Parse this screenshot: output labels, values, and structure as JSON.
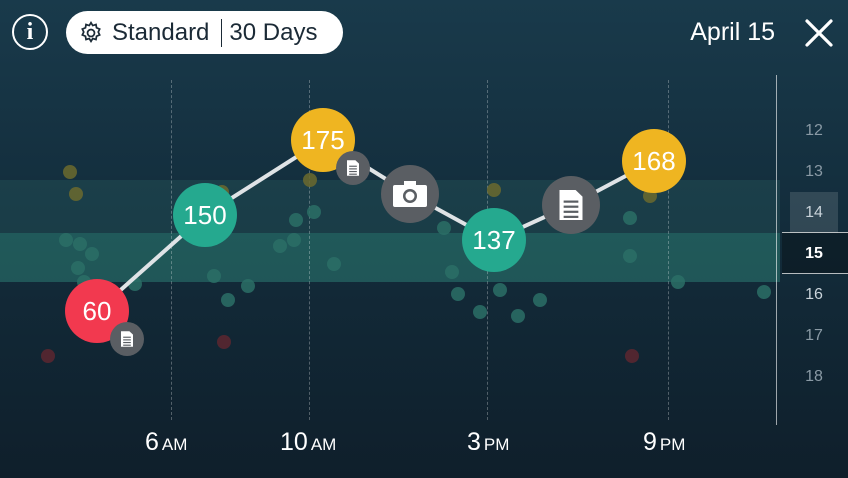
{
  "header": {
    "info_icon": "info-icon",
    "info_glyph": "i",
    "filter": {
      "mode": "Standard",
      "period": "30 Days",
      "icon": "gear-icon"
    },
    "date": "April 15",
    "close_icon": "close-icon"
  },
  "colors": {
    "high": "#efb521",
    "in_range": "#25a98f",
    "low": "#f2394f",
    "note_badge": "#5a5e63",
    "line": "#dfe3e6"
  },
  "chart_data": {
    "type": "line",
    "x_axis": [
      {
        "num": "6",
        "unit": "AM"
      },
      {
        "num": "10",
        "unit": "AM"
      },
      {
        "num": "3",
        "unit": "PM"
      },
      {
        "num": "9",
        "unit": "PM"
      }
    ],
    "readings": [
      {
        "value": 60,
        "level": "low",
        "attachment": "note"
      },
      {
        "value": 150,
        "level": "in_range",
        "attachment": null
      },
      {
        "value": 175,
        "level": "high",
        "attachment": "note"
      },
      {
        "value": null,
        "level": "photo",
        "attachment": "photo-icon"
      },
      {
        "value": 137,
        "level": "in_range",
        "attachment": null
      },
      {
        "value": null,
        "level": "note",
        "attachment": "note-icon"
      },
      {
        "value": 168,
        "level": "high",
        "attachment": null
      }
    ]
  },
  "day_scale": {
    "days": [
      "12",
      "13",
      "14",
      "15",
      "16",
      "17",
      "18"
    ],
    "selected": "15"
  }
}
